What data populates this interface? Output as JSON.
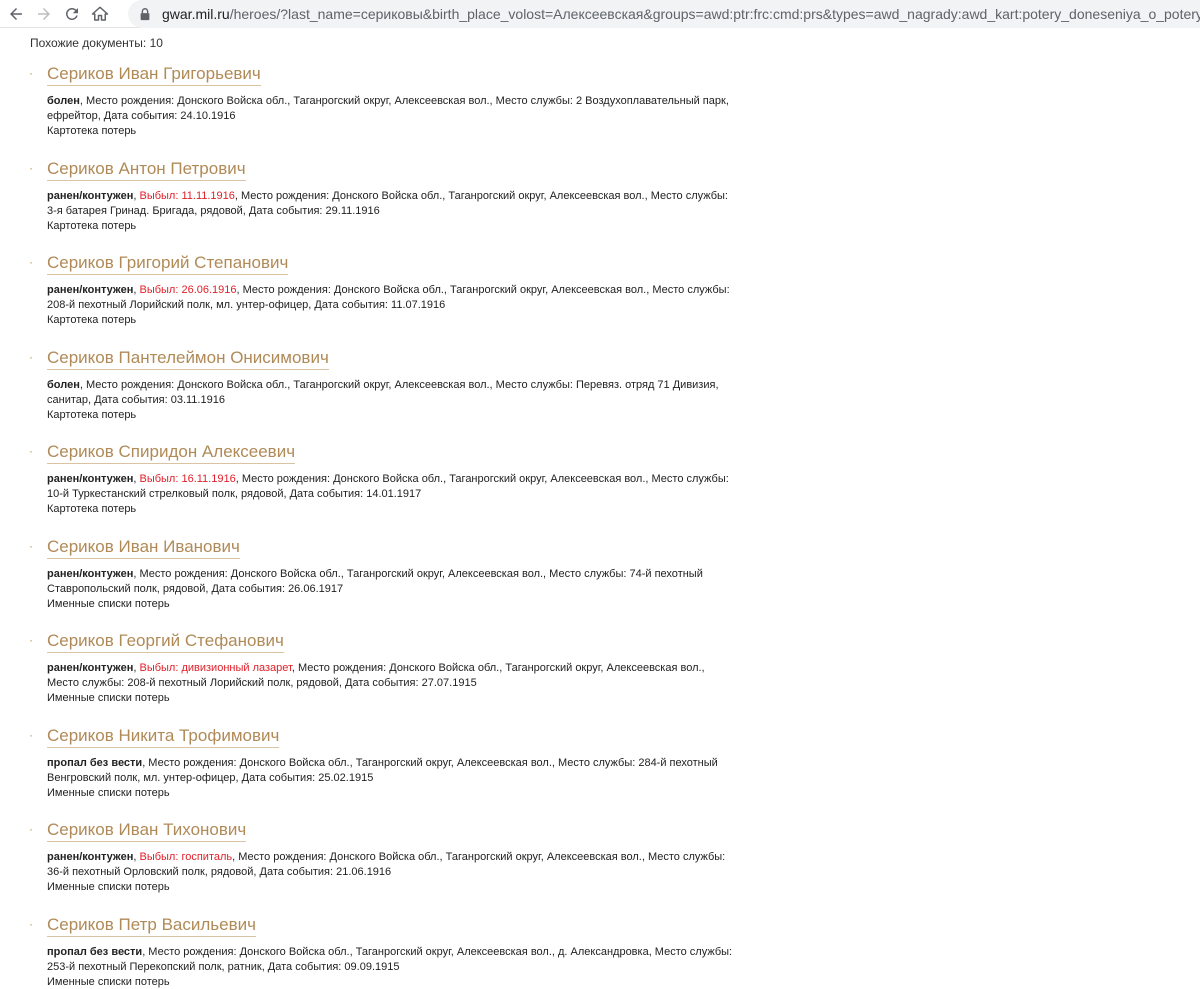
{
  "browser": {
    "url_domain": "gwar.mil.ru",
    "url_path": "/heroes/?last_name=сериковы&birth_place_volost=Алексеевская&groups=awd:ptr:frc:cmd:prs&types=awd_nagrady:awd_kart:potery_doneseniya_o_poteryah"
  },
  "similar_documents_label": "Похожие документы: 10",
  "results": [
    {
      "name": "Сериков Иван Григорьевич",
      "status": "болен",
      "left": "",
      "details": ", Место рождения: Донского Войска обл., Таганрогский округ, Алексеевская вол., Место службы: 2 Воздухоплавательный парк, ефрейтор, Дата события: 24.10.1916",
      "source": "Картотека потерь"
    },
    {
      "name": "Сериков Антон Петрович",
      "status": "ранен/контужен",
      "left": "Выбыл: 11.11.1916",
      "details": ", Место рождения: Донского Войска обл., Таганрогский округ, Алексеевская вол., Место службы: 3-я батарея Гринад. Бригада, рядовой, Дата события: 29.11.1916",
      "source": "Картотека потерь"
    },
    {
      "name": "Сериков Григорий Степанович",
      "status": "ранен/контужен",
      "left": "Выбыл: 26.06.1916",
      "details": ", Место рождения: Донского Войска обл., Таганрогский округ, Алексеевская вол., Место службы: 208-й пехотный Лорийский полк, мл. унтер-офицер, Дата события: 11.07.1916",
      "source": "Картотека потерь"
    },
    {
      "name": "Сериков Пантелеймон Онисимович",
      "status": "болен",
      "left": "",
      "details": ", Место рождения: Донского Войска обл., Таганрогский округ, Алексеевская вол., Место службы: Перевяз. отряд 71 Дивизия, санитар, Дата события: 03.11.1916",
      "source": "Картотека потерь"
    },
    {
      "name": "Сериков Спиридон Алексеевич",
      "status": "ранен/контужен",
      "left": "Выбыл: 16.11.1916",
      "details": ", Место рождения: Донского Войска обл., Таганрогский округ, Алексеевская вол., Место службы: 10-й Туркестанский стрелковый полк, рядовой, Дата события: 14.01.1917",
      "source": "Картотека потерь"
    },
    {
      "name": "Сериков Иван Иванович",
      "status": "ранен/контужен",
      "left": "",
      "details": ", Место рождения: Донского Войска обл., Таганрогский округ, Алексеевская вол., Место службы: 74-й пехотный Ставропольский полк, рядовой, Дата события: 26.06.1917",
      "source": "Именные списки потерь"
    },
    {
      "name": "Сериков Георгий Стефанович",
      "status": "ранен/контужен",
      "left": "Выбыл: дивизионный лазарет",
      "details": ", Место рождения: Донского Войска обл., Таганрогский округ, Алексеевская вол., Место службы: 208-й пехотный Лорийский полк, рядовой, Дата события: 27.07.1915",
      "source": "Именные списки потерь"
    },
    {
      "name": "Сериков Никита Трофимович",
      "status": "пропал без вести",
      "left": "",
      "details": ", Место рождения: Донского Войска обл., Таганрогский округ, Алексеевская вол., Место службы: 284-й пехотный Венгровский полк, мл. унтер-офицер, Дата события: 25.02.1915",
      "source": "Именные списки потерь"
    },
    {
      "name": "Сериков Иван Тихонович",
      "status": "ранен/контужен",
      "left": "Выбыл: госпиталь",
      "details": ", Место рождения: Донского Войска обл., Таганрогский округ, Алексеевская вол., Место службы: 36-й пехотный Орловский полк, рядовой, Дата события: 21.06.1916",
      "source": "Именные списки потерь"
    },
    {
      "name": "Сериков Петр Васильевич",
      "status": "пропал без вести",
      "left": "",
      "details": ", Место рождения: Донского Войска обл., Таганрогский округ, Алексеевская вол., д. Александровка, Место службы: 253-й пехотный Перекопский полк, ратник, Дата события: 09.09.1915",
      "source": "Именные списки потерь"
    }
  ],
  "colors": {
    "name_link": "#b08a57",
    "left_red": "#e0202a",
    "bullet": "#b8915a"
  }
}
